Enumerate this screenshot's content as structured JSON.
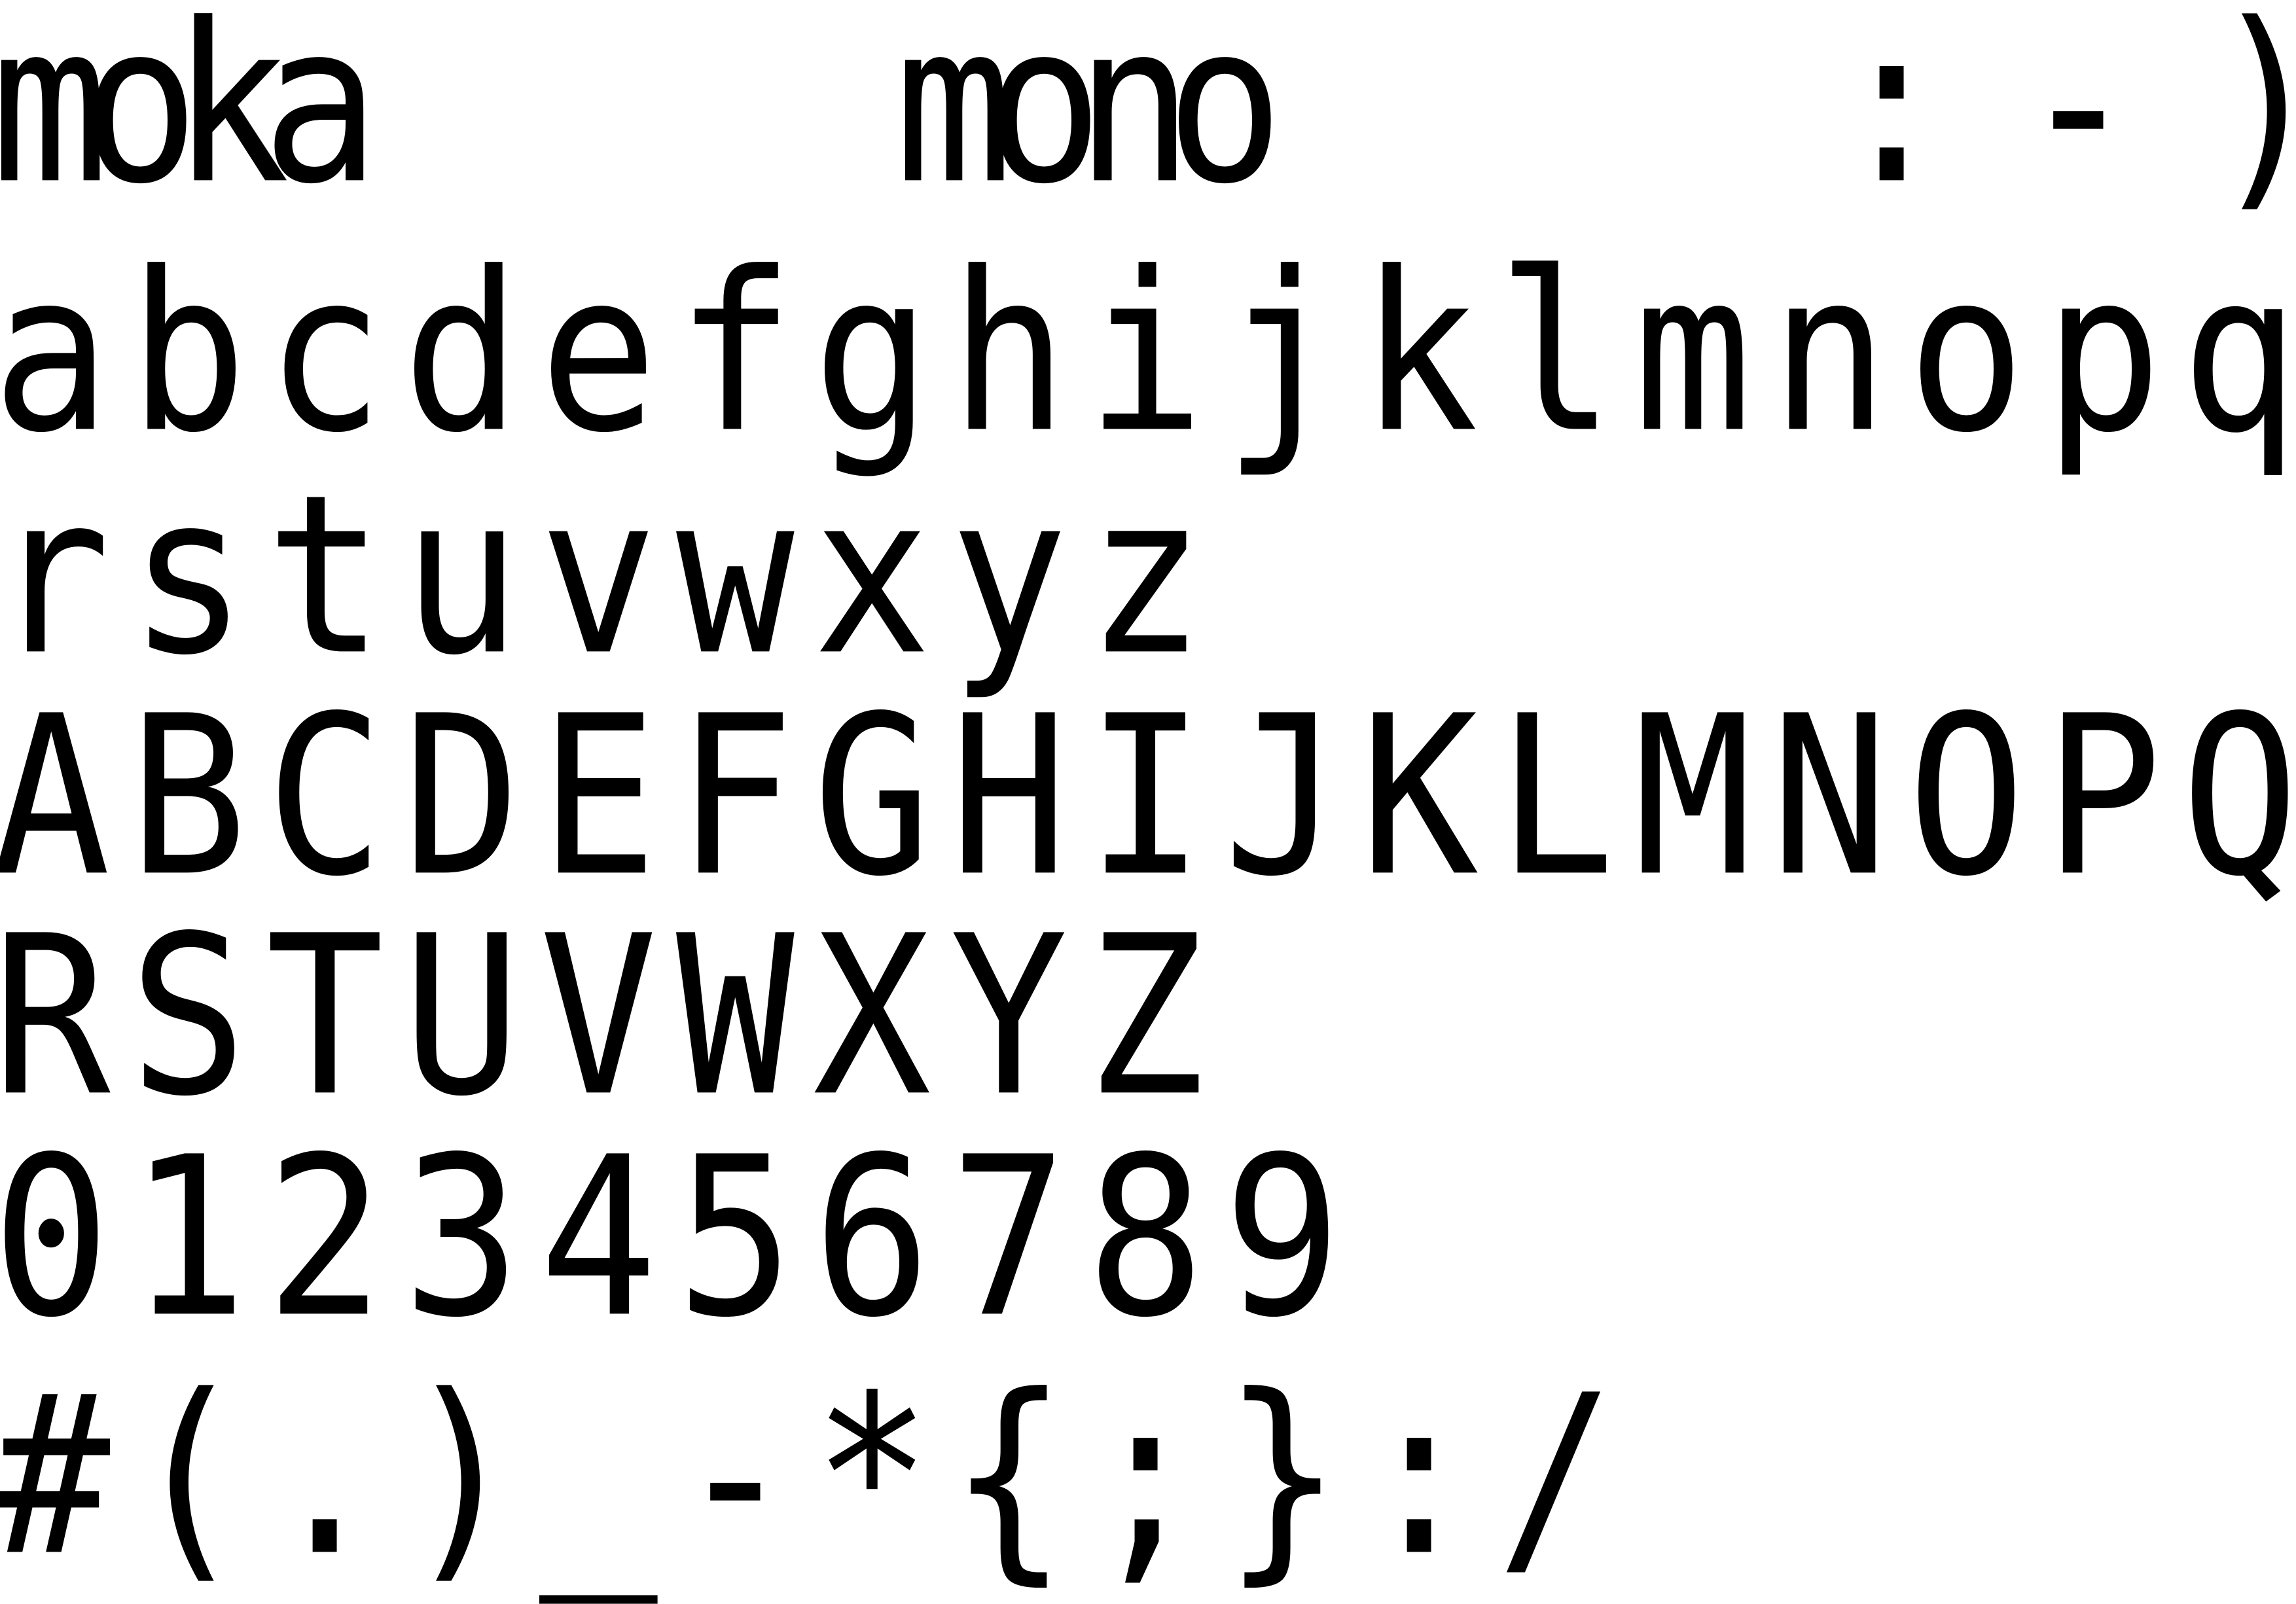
{
  "specimen": {
    "colors": {
      "ink": "#000000",
      "background": "#ffffff"
    },
    "lines": [
      "moka mono :-)",
      "abcdefghijklmnopq",
      "rstuvwxyz",
      "ABCDEFGHIJKLMNOPQ",
      "RSTUVWXYZ",
      "0123456789",
      "#(.)_-*{;}:/"
    ]
  }
}
